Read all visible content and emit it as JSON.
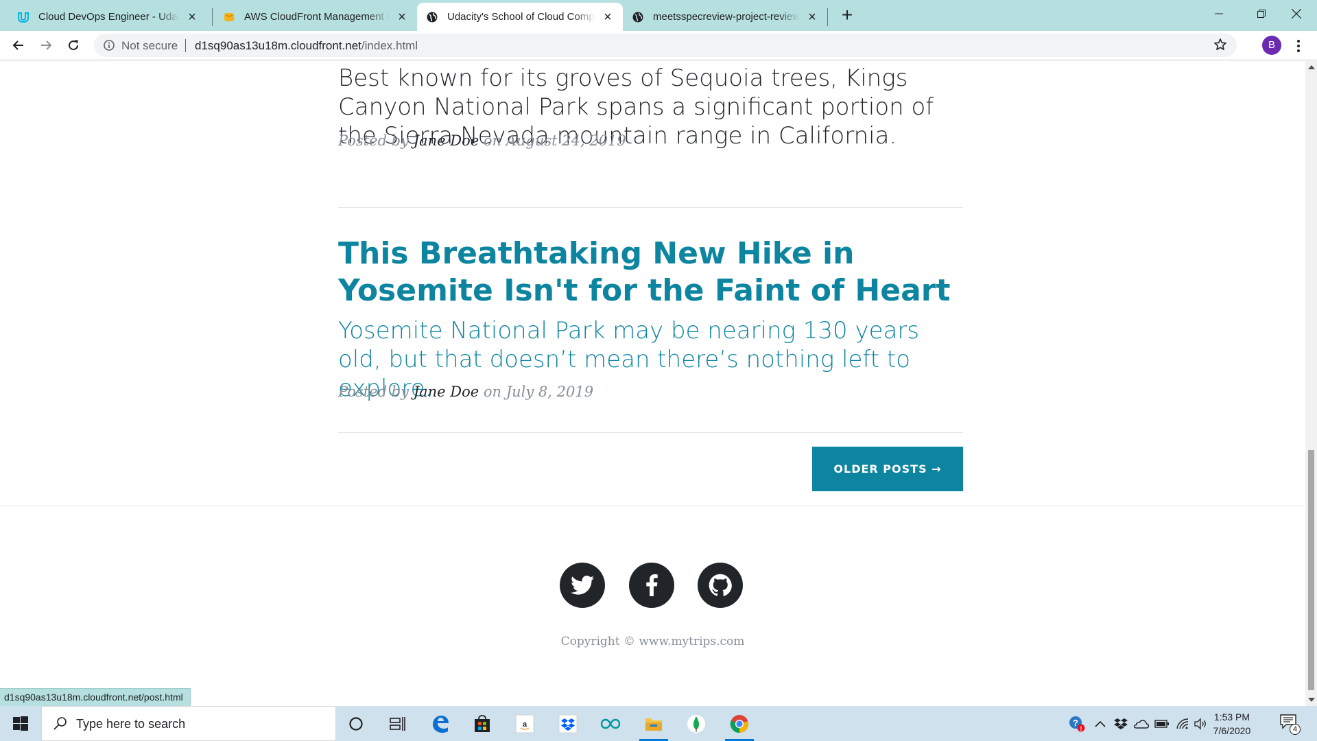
{
  "browser": {
    "tabs": [
      {
        "title": "Cloud DevOps Engineer - Udacity",
        "icon": "udacity-icon",
        "active": false
      },
      {
        "title": "AWS CloudFront Management Console",
        "icon": "aws-icon",
        "active": false
      },
      {
        "title": "Udacity's School of Cloud Computing",
        "icon": "globe-icon",
        "active": true
      },
      {
        "title": "meetsspecreview-project-review",
        "icon": "globe-icon",
        "active": false
      }
    ],
    "security_label": "Not secure",
    "url_host": "d1sq90as13u18m.cloudfront.net",
    "url_path": "/index.html",
    "profile_initial": "B",
    "status_url": "d1sq90as13u18m.cloudfront.net/post.html"
  },
  "page": {
    "posts": [
      {
        "title": "",
        "subtitle": "Best known for its groves of Sequoia trees, Kings Canyon National Park spans a significant portion of the Sierra Nevada mountain range in California.",
        "meta_prefix": "Posted by",
        "author": "Jane Doe",
        "meta_middle": "on",
        "date": "August 24, 2019"
      },
      {
        "title": "This Breathtaking New Hike in Yosemite Isn't for the Faint of Heart",
        "subtitle": "Yosemite National Park may be nearing 130 years old, but that doesn’t mean there’s nothing left to explore.",
        "meta_prefix": "Posted by",
        "author": "Jane Doe",
        "meta_middle": "on",
        "date": "July 8, 2019"
      }
    ],
    "older_posts_label": "OLDER POSTS →",
    "social": [
      "twitter-icon",
      "facebook-icon",
      "github-icon"
    ],
    "copyright": "Copyright © www.mytrips.com"
  },
  "taskbar": {
    "search_placeholder": "Type here to search",
    "time": "1:53 PM",
    "date": "7/6/2020",
    "notification_count": "4",
    "apps": [
      "cortana-icon",
      "task-view-icon",
      "edge-icon",
      "store-icon",
      "amazon-icon",
      "dropbox-icon",
      "arduino-icon",
      "file-explorer-icon",
      "mongodb-icon",
      "chrome-icon"
    ]
  },
  "colors": {
    "accent": "#0d85a0",
    "tabstrip": "#b6e0df",
    "text_dark": "#212529",
    "text_muted": "#868e96"
  }
}
